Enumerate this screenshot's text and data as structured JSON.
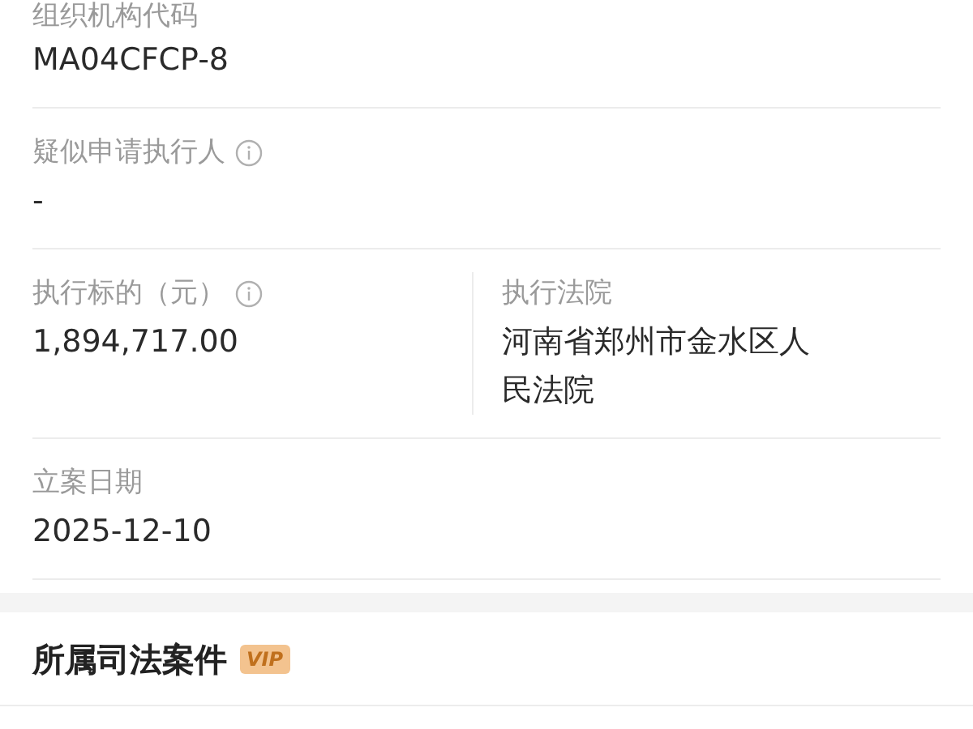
{
  "rows": [
    {
      "fields": [
        {
          "label": "组织机构代码",
          "info": false,
          "values": [
            "MA04CFCP-8"
          ]
        }
      ]
    },
    {
      "fields": [
        {
          "label": "疑似申请执行人",
          "info": true,
          "values": [
            "-"
          ]
        }
      ]
    },
    {
      "fields": [
        {
          "label": "执行标的（元）",
          "info": true,
          "values": [
            "1,894,717.00"
          ]
        },
        {
          "label": "执行法院",
          "info": false,
          "values": [
            "河南省郑州市金水区人",
            "民法院"
          ]
        }
      ]
    },
    {
      "fields": [
        {
          "label": "立案日期",
          "info": false,
          "values": [
            "2025-12-10"
          ]
        }
      ]
    }
  ],
  "section": {
    "title": "所属司法案件",
    "badge": "VIP"
  }
}
